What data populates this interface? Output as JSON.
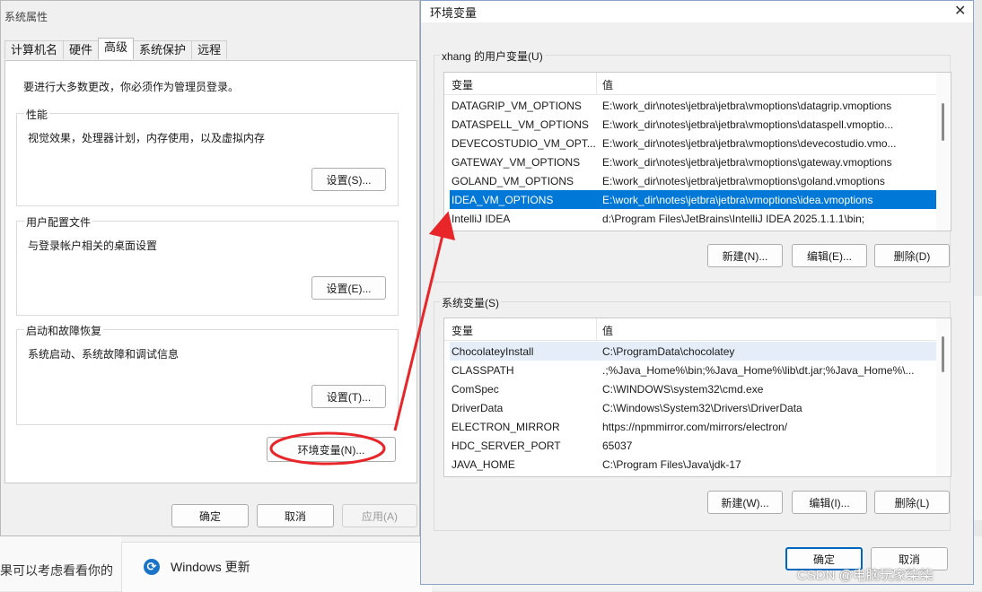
{
  "background": {
    "left_text": "果可以考虑看看你的",
    "windows_update": "Windows 更新",
    "watermark": "CSDN @电脑玩家柒柒"
  },
  "system_properties": {
    "title": "系统属性",
    "tabs": [
      {
        "label": "计算机名",
        "active": false
      },
      {
        "label": "硬件",
        "active": false
      },
      {
        "label": "高级",
        "active": true
      },
      {
        "label": "系统保护",
        "active": false
      },
      {
        "label": "远程",
        "active": false
      }
    ],
    "admin_notice": "要进行大多数更改，你必须作为管理员登录。",
    "performance": {
      "legend": "性能",
      "desc": "视觉效果，处理器计划，内存使用，以及虚拟内存",
      "button": "设置(S)..."
    },
    "user_profiles": {
      "legend": "用户配置文件",
      "desc": "与登录帐户相关的桌面设置",
      "button": "设置(E)..."
    },
    "startup_recovery": {
      "legend": "启动和故障恢复",
      "desc": "系统启动、系统故障和调试信息",
      "button": "设置(T)..."
    },
    "env_vars_button": "环境变量(N)...",
    "ok": "确定",
    "cancel": "取消",
    "apply": "应用(A)"
  },
  "env_vars": {
    "title": "环境变量",
    "close_glyph": "✕",
    "user_section": {
      "legend": "xhang 的用户变量(U)",
      "col_var": "变量",
      "col_val": "值",
      "rows": [
        {
          "name": "DATAGRIP_VM_OPTIONS",
          "value": "E:\\work_dir\\notes\\jetbra\\jetbra\\vmoptions\\datagrip.vmoptions",
          "selected": false
        },
        {
          "name": "DATASPELL_VM_OPTIONS",
          "value": "E:\\work_dir\\notes\\jetbra\\jetbra\\vmoptions\\dataspell.vmoptio...",
          "selected": false
        },
        {
          "name": "DEVECOSTUDIO_VM_OPT...",
          "value": "E:\\work_dir\\notes\\jetbra\\jetbra\\vmoptions\\devecostudio.vmo...",
          "selected": false
        },
        {
          "name": "GATEWAY_VM_OPTIONS",
          "value": "E:\\work_dir\\notes\\jetbra\\jetbra\\vmoptions\\gateway.vmoptions",
          "selected": false
        },
        {
          "name": "GOLAND_VM_OPTIONS",
          "value": "E:\\work_dir\\notes\\jetbra\\jetbra\\vmoptions\\goland.vmoptions",
          "selected": false
        },
        {
          "name": "IDEA_VM_OPTIONS",
          "value": "E:\\work_dir\\notes\\jetbra\\jetbra\\vmoptions\\idea.vmoptions",
          "selected": true
        },
        {
          "name": "IntelliJ IDEA",
          "value": "d:\\Program Files\\JetBrains\\IntelliJ IDEA 2025.1.1.1\\bin;",
          "selected": false
        }
      ],
      "new_button": "新建(N)...",
      "edit_button": "编辑(E)...",
      "delete_button": "删除(D)"
    },
    "system_section": {
      "legend": "系统变量(S)",
      "col_var": "变量",
      "col_val": "值",
      "rows": [
        {
          "name": "ChocolateyInstall",
          "value": "C:\\ProgramData\\chocolatey",
          "selected": false
        },
        {
          "name": "CLASSPATH",
          "value": ".;%Java_Home%\\bin;%Java_Home%\\lib\\dt.jar;%Java_Home%\\...",
          "selected": false
        },
        {
          "name": "ComSpec",
          "value": "C:\\WINDOWS\\system32\\cmd.exe",
          "selected": false
        },
        {
          "name": "DriverData",
          "value": "C:\\Windows\\System32\\Drivers\\DriverData",
          "selected": false
        },
        {
          "name": "ELECTRON_MIRROR",
          "value": "https://npmmirror.com/mirrors/electron/",
          "selected": false
        },
        {
          "name": "HDC_SERVER_PORT",
          "value": "65037",
          "selected": false
        },
        {
          "name": "JAVA_HOME",
          "value": "C:\\Program Files\\Java\\jdk-17",
          "selected": false
        }
      ],
      "new_button": "新建(W)...",
      "edit_button": "编辑(I)...",
      "delete_button": "删除(L)"
    },
    "ok": "确定",
    "cancel": "取消"
  },
  "colors": {
    "selection": "#0078d7",
    "annotation_red": "#e8262a",
    "primary_border": "#0067c0"
  }
}
